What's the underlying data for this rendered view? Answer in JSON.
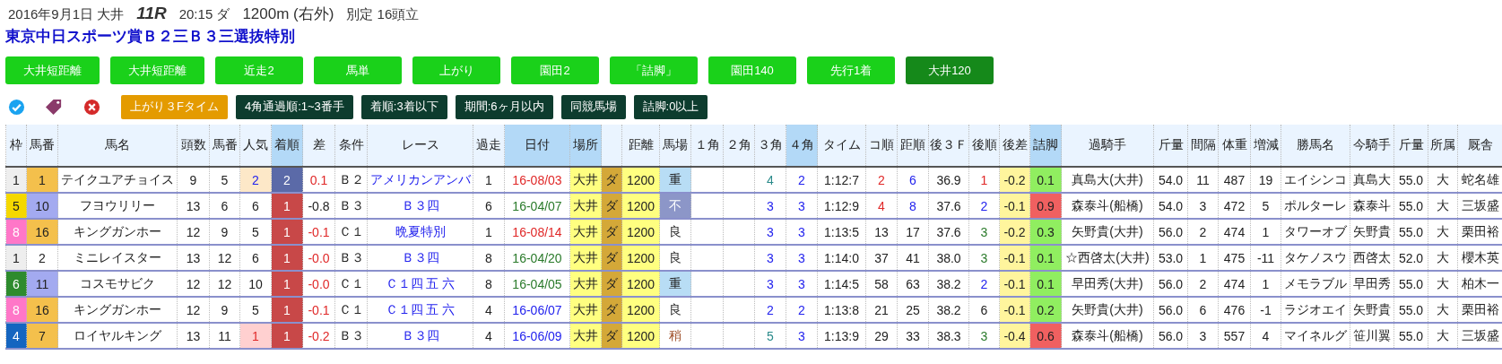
{
  "race_info": {
    "date_venue": "2016年9月1日 大井",
    "race_number": "11R",
    "time_track": "20:15 ダ",
    "distance": "1200m (右外)",
    "conditions": "別定 16頭立"
  },
  "race_title": "東京中日スポーツ賞Ｂ２三Ｂ３三選抜特別",
  "filter_buttons": [
    {
      "label": "大井短距離",
      "selected": false
    },
    {
      "label": "大井短距離",
      "selected": false
    },
    {
      "label": "近走2",
      "selected": false
    },
    {
      "label": "馬単",
      "selected": false
    },
    {
      "label": "上がり",
      "selected": false
    },
    {
      "label": "園田2",
      "selected": false
    },
    {
      "label": "「詰脚」",
      "selected": false
    },
    {
      "label": "園田140",
      "selected": false
    },
    {
      "label": "先行1着",
      "selected": false
    },
    {
      "label": "大井120",
      "selected": true
    }
  ],
  "toolbar": {
    "sort_chip": "上がり３Fタイム",
    "chips": [
      "4角通過順:1~3番手",
      "着順:3着以下",
      "期間:6ヶ月以内",
      "同競馬場",
      "詰脚:0以上"
    ]
  },
  "table": {
    "columns": [
      {
        "label": "枠",
        "highlighted": false
      },
      {
        "label": "馬番",
        "highlighted": false
      },
      {
        "label": "馬名",
        "highlighted": false
      },
      {
        "label": "頭数",
        "highlighted": false
      },
      {
        "label": "馬番",
        "highlighted": false
      },
      {
        "label": "人気",
        "highlighted": false
      },
      {
        "label": "着順",
        "highlighted": true
      },
      {
        "label": "差",
        "highlighted": false
      },
      {
        "label": "条件",
        "highlighted": false
      },
      {
        "label": "レース",
        "highlighted": false
      },
      {
        "label": "過走",
        "highlighted": false
      },
      {
        "label": "日付",
        "highlighted": true
      },
      {
        "label": "場所",
        "highlighted": true
      },
      {
        "highlighted": false
      },
      {
        "label": "距離",
        "highlighted": false
      },
      {
        "label": "馬場",
        "highlighted": false
      },
      {
        "label": "１角",
        "highlighted": false
      },
      {
        "label": "２角",
        "highlighted": false
      },
      {
        "label": "３角",
        "highlighted": false
      },
      {
        "label": "４角",
        "highlighted": true
      },
      {
        "label": "タイム",
        "highlighted": false
      },
      {
        "label": "コ順",
        "highlighted": false
      },
      {
        "label": "距順",
        "highlighted": false
      },
      {
        "label": "後３Ｆ",
        "highlighted": false
      },
      {
        "label": "後順",
        "highlighted": false
      },
      {
        "label": "後差",
        "highlighted": false
      },
      {
        "label": "詰脚",
        "highlighted": true
      },
      {
        "label": "過騎手",
        "highlighted": false
      },
      {
        "label": "斤量",
        "highlighted": false
      },
      {
        "label": "間隔",
        "highlighted": false
      },
      {
        "label": "体重",
        "highlighted": false
      },
      {
        "label": "増減",
        "highlighted": false
      },
      {
        "label": "勝馬名",
        "highlighted": false
      },
      {
        "label": "今騎手",
        "highlighted": false
      },
      {
        "label": "斤量",
        "highlighted": false
      },
      {
        "label": "所属",
        "highlighted": false
      },
      {
        "label": "厩舎",
        "highlighted": false
      }
    ],
    "rows": [
      [
        {
          "text": "1",
          "color": "#eeeeee"
        },
        {
          "text": "1",
          "color": "#f4c04c"
        },
        "テイクユアチョイス",
        "9",
        "5",
        {
          "text": "2",
          "kind": "blue",
          "color": "#fde8c8"
        },
        {
          "text": "2",
          "kind": "white",
          "color": "#5b6aa8"
        },
        {
          "text": "0.1",
          "kind": "red"
        },
        "Ｂ２",
        {
          "text": "アメリカンアンバ",
          "kind": "blue"
        },
        "1",
        {
          "text": "16-08/03",
          "kind": "red"
        },
        {
          "text": "大井",
          "color": "#ffff80"
        },
        {
          "text": "ダ",
          "color": "#d4a838"
        },
        {
          "text": "1200",
          "color": "#ffff80"
        },
        {
          "text": "重",
          "color": "#b8ddf5"
        },
        null,
        null,
        {
          "text": "4",
          "kind": "teal"
        },
        {
          "text": "2",
          "kind": "blue"
        },
        "1:12:7",
        {
          "text": "2",
          "kind": "red"
        },
        {
          "text": "6",
          "kind": "blue"
        },
        "36.9",
        {
          "text": "1",
          "kind": "red"
        },
        {
          "text": "-0.2",
          "color": "#fff59d"
        },
        {
          "text": "0.1",
          "color": "#90ee60"
        },
        "真島大(大井)",
        "54.0",
        "11",
        "487",
        "19",
        "エイシンコ",
        "真島大",
        "55.0",
        "大",
        "蛇名雄"
      ],
      [
        {
          "text": "5",
          "color": "#f5d800"
        },
        {
          "text": "10",
          "color": "#a3aaf0"
        },
        "フヨウリリー",
        "13",
        "6",
        "6",
        {
          "text": "1",
          "kind": "white",
          "color": "#c84848"
        },
        "-0.8",
        "Ｂ３",
        {
          "text": "Ｂ３四",
          "kind": "blue"
        },
        "6",
        {
          "text": "16-04/07",
          "kind": "green"
        },
        {
          "text": "大井",
          "color": "#ffff80"
        },
        {
          "text": "ダ",
          "color": "#d4a838"
        },
        {
          "text": "1200",
          "color": "#ffff80"
        },
        {
          "text": "不",
          "kind": "white",
          "color": "#8c96c8"
        },
        null,
        null,
        {
          "text": "3",
          "kind": "blue"
        },
        {
          "text": "3",
          "kind": "blue"
        },
        "1:12:9",
        {
          "text": "4",
          "kind": "red"
        },
        {
          "text": "8",
          "kind": "blue"
        },
        "37.6",
        {
          "text": "2",
          "kind": "blue"
        },
        {
          "text": "-0.1",
          "color": "#fff59d"
        },
        {
          "text": "0.9",
          "color": "#f06060"
        },
        "森泰斗(船橋)",
        "54.0",
        "3",
        "472",
        "5",
        "ポルターレ",
        "森泰斗",
        "55.0",
        "大",
        "三坂盛"
      ],
      [
        {
          "text": "8",
          "kind": "white",
          "color": "#ff77c8"
        },
        {
          "text": "16",
          "color": "#f4c04c"
        },
        "キングガンホー",
        "12",
        "9",
        "5",
        {
          "text": "1",
          "kind": "white",
          "color": "#c84848"
        },
        {
          "text": "-0.1",
          "kind": "red"
        },
        "Ｃ１",
        {
          "text": "晩夏特別",
          "kind": "blue"
        },
        "1",
        {
          "text": "16-08/14",
          "kind": "red"
        },
        {
          "text": "大井",
          "color": "#ffff80"
        },
        {
          "text": "ダ",
          "color": "#d4a838"
        },
        {
          "text": "1200",
          "color": "#ffff80"
        },
        "良",
        null,
        null,
        {
          "text": "3",
          "kind": "blue"
        },
        {
          "text": "3",
          "kind": "blue"
        },
        "1:13:5",
        "13",
        "17",
        "37.6",
        {
          "text": "3",
          "kind": "green"
        },
        {
          "text": "-0.2",
          "color": "#fff59d"
        },
        {
          "text": "0.3",
          "color": "#90ee60"
        },
        "矢野貴(大井)",
        "56.0",
        "2",
        "474",
        "1",
        "タワーオブ",
        "矢野貴",
        "55.0",
        "大",
        "栗田裕"
      ],
      [
        {
          "text": "1",
          "color": "#eeeeee"
        },
        "2",
        "ミニレイスター",
        "13",
        "12",
        "6",
        {
          "text": "1",
          "kind": "white",
          "color": "#c84848"
        },
        {
          "text": "-0.0",
          "kind": "red"
        },
        "Ｂ３",
        {
          "text": "Ｂ３四",
          "kind": "blue"
        },
        "8",
        {
          "text": "16-04/20",
          "kind": "green"
        },
        {
          "text": "大井",
          "color": "#ffff80"
        },
        {
          "text": "ダ",
          "color": "#d4a838"
        },
        {
          "text": "1200",
          "color": "#ffff80"
        },
        "良",
        null,
        null,
        {
          "text": "3",
          "kind": "blue"
        },
        {
          "text": "3",
          "kind": "blue"
        },
        "1:14:0",
        "37",
        "41",
        "38.0",
        {
          "text": "3",
          "kind": "green"
        },
        {
          "text": "-0.1",
          "color": "#fff59d"
        },
        {
          "text": "0.1",
          "color": "#90ee60"
        },
        "☆西啓太(大井)",
        "53.0",
        "1",
        "475",
        "-11",
        "タケノスウ",
        "西啓太",
        "52.0",
        "大",
        "櫻木英"
      ],
      [
        {
          "text": "6",
          "kind": "white",
          "color": "#2e8b2e"
        },
        {
          "text": "11",
          "color": "#a3aaf0"
        },
        "コスモサビク",
        "12",
        "12",
        "10",
        {
          "text": "1",
          "kind": "white",
          "color": "#c84848"
        },
        {
          "text": "-0.0",
          "kind": "red"
        },
        "Ｃ１",
        {
          "text": "Ｃ１四 五 六",
          "kind": "blue"
        },
        "8",
        {
          "text": "16-04/05",
          "kind": "green"
        },
        {
          "text": "大井",
          "color": "#ffff80"
        },
        {
          "text": "ダ",
          "color": "#d4a838"
        },
        {
          "text": "1200",
          "color": "#ffff80"
        },
        {
          "text": "重",
          "color": "#b8ddf5"
        },
        null,
        null,
        {
          "text": "3",
          "kind": "blue"
        },
        {
          "text": "3",
          "kind": "blue"
        },
        "1:14:5",
        "58",
        "63",
        "38.2",
        {
          "text": "2",
          "kind": "blue"
        },
        {
          "text": "-0.1",
          "color": "#fff59d"
        },
        {
          "text": "0.1",
          "color": "#90ee60"
        },
        "早田秀(大井)",
        "56.0",
        "2",
        "474",
        "1",
        "メモラブル",
        "早田秀",
        "55.0",
        "大",
        "柏木一"
      ],
      [
        {
          "text": "8",
          "kind": "white",
          "color": "#ff77c8"
        },
        {
          "text": "16",
          "color": "#f4c04c"
        },
        "キングガンホー",
        "12",
        "9",
        "5",
        {
          "text": "1",
          "kind": "white",
          "color": "#c84848"
        },
        {
          "text": "-0.1",
          "kind": "red"
        },
        "Ｃ１",
        {
          "text": "Ｃ１四 五 六",
          "kind": "blue"
        },
        "4",
        {
          "text": "16-06/07",
          "kind": "blue"
        },
        {
          "text": "大井",
          "color": "#ffff80"
        },
        {
          "text": "ダ",
          "color": "#d4a838"
        },
        {
          "text": "1200",
          "color": "#ffff80"
        },
        "良",
        null,
        null,
        {
          "text": "2",
          "kind": "blue"
        },
        {
          "text": "2",
          "kind": "blue"
        },
        "1:13:8",
        "21",
        "25",
        "38.2",
        "6",
        {
          "text": "-0.1",
          "color": "#fff59d"
        },
        {
          "text": "0.2",
          "color": "#90ee60"
        },
        "矢野貴(大井)",
        "56.0",
        "6",
        "476",
        "-1",
        "ラジオエイ",
        "矢野貴",
        "55.0",
        "大",
        "栗田裕"
      ],
      [
        {
          "text": "4",
          "kind": "white",
          "color": "#1565c0"
        },
        {
          "text": "7",
          "color": "#f4c04c"
        },
        "ロイヤルキング",
        "13",
        "11",
        {
          "text": "1",
          "kind": "red",
          "color": "#ffd0d0"
        },
        {
          "text": "1",
          "kind": "white",
          "color": "#c84848"
        },
        {
          "text": "-0.2",
          "kind": "red"
        },
        "Ｂ３",
        {
          "text": "Ｂ３四",
          "kind": "blue"
        },
        "4",
        {
          "text": "16-06/09",
          "kind": "blue"
        },
        {
          "text": "大井",
          "color": "#ffff80"
        },
        {
          "text": "ダ",
          "color": "#d4a838"
        },
        {
          "text": "1200",
          "color": "#ffff80"
        },
        {
          "text": "稍",
          "kind": "brown"
        },
        null,
        null,
        {
          "text": "5",
          "kind": "teal"
        },
        {
          "text": "3",
          "kind": "blue"
        },
        "1:13:9",
        "29",
        "33",
        "38.3",
        {
          "text": "3",
          "kind": "green"
        },
        {
          "text": "-0.4",
          "color": "#fff59d"
        },
        {
          "text": "0.6",
          "color": "#f06060"
        },
        "森泰斗(船橋)",
        "56.0",
        "3",
        "557",
        "4",
        "マイネルグ",
        "笹川翼",
        "55.0",
        "大",
        "三坂盛"
      ]
    ]
  }
}
